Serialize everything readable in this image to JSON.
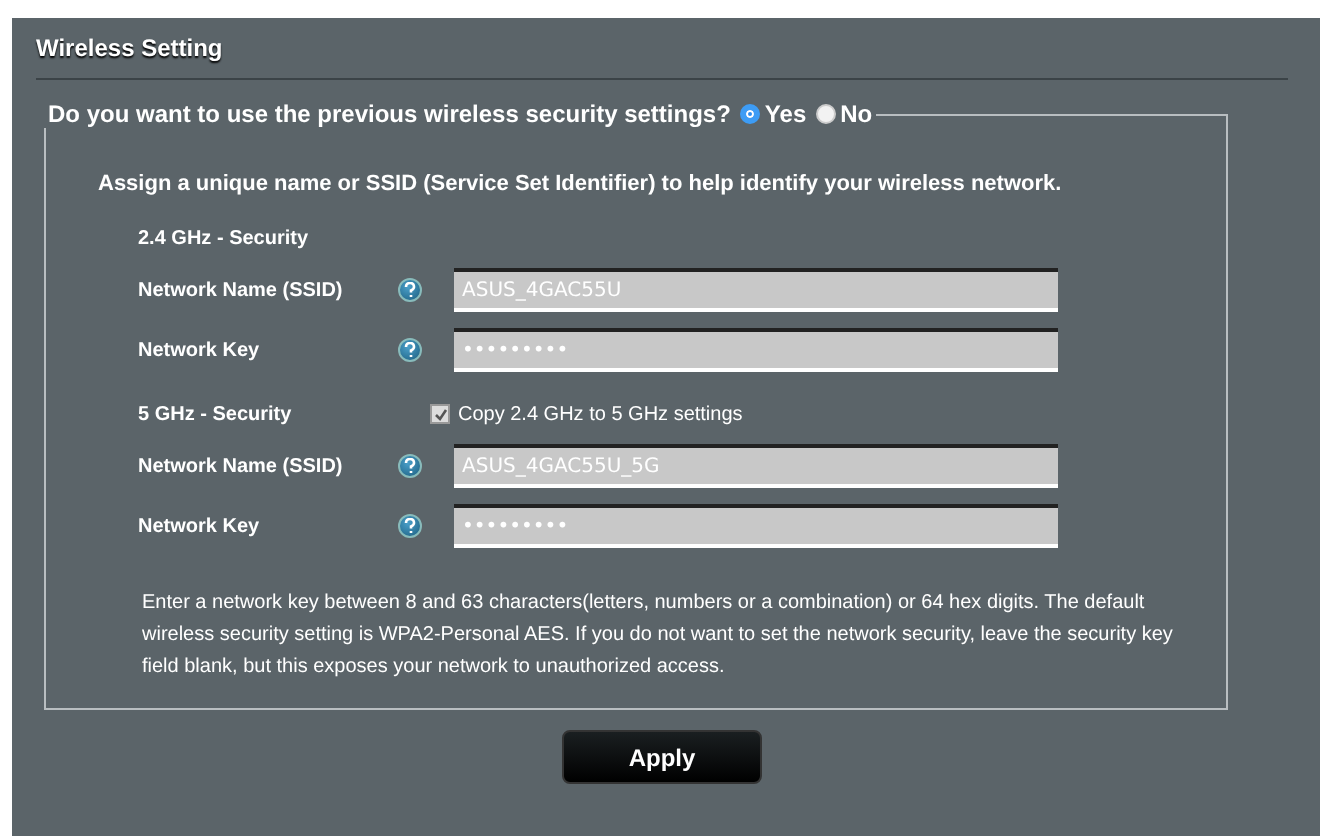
{
  "title": "Wireless Setting",
  "question": {
    "label": "Do you want to use the previous wireless security settings?",
    "options": [
      {
        "label": "Yes",
        "selected": true
      },
      {
        "label": "No",
        "selected": false
      }
    ]
  },
  "intro": "Assign a unique name or SSID (Service Set Identifier) to help identify your wireless network.",
  "bands": [
    {
      "heading": "2.4 GHz - Security",
      "fields": [
        {
          "label": "Network Name (SSID)",
          "value": "ASUS_4GAC55U"
        },
        {
          "label": "Network Key",
          "value": "•••••••••"
        }
      ]
    },
    {
      "heading": "5 GHz - Security",
      "copy": {
        "label": "Copy 2.4 GHz to 5 GHz settings",
        "checked": true
      },
      "fields": [
        {
          "label": "Network Name (SSID)",
          "value": "ASUS_4GAC55U_5G"
        },
        {
          "label": "Network Key",
          "value": "•••••••••"
        }
      ]
    }
  ],
  "note": "Enter a network key between 8 and 63 characters(letters, numbers or a combination) or 64 hex digits. The default wireless security setting is WPA2-Personal AES. If you do not want to set the network security, leave the security key field blank, but this exposes your network to unauthorized access.",
  "apply": "Apply"
}
